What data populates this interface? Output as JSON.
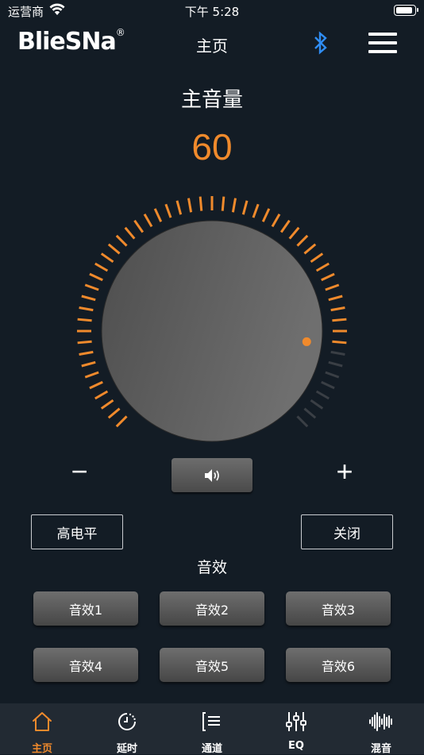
{
  "status_bar": {
    "carrier": "运营商",
    "time": "下午 5:28",
    "battery_level": 1.0
  },
  "nav": {
    "logo": "BlieSNa",
    "logo_mark": "®",
    "title": "主页"
  },
  "volume": {
    "label": "主音量",
    "value": 60,
    "max": 70
  },
  "controls": {
    "minus": "−",
    "plus": "+",
    "high_level": "高电平",
    "close": "关闭"
  },
  "effects": {
    "label": "音效",
    "buttons": [
      "音效1",
      "音效2",
      "音效3",
      "音效4",
      "音效5",
      "音效6"
    ]
  },
  "tabs": [
    {
      "label": "主页",
      "icon": "home-icon",
      "active": true
    },
    {
      "label": "延时",
      "icon": "clock-icon",
      "active": false
    },
    {
      "label": "通道",
      "icon": "list-icon",
      "active": false
    },
    {
      "label": "EQ",
      "icon": "sliders-icon",
      "active": false
    },
    {
      "label": "混音",
      "icon": "waveform-icon",
      "active": false
    }
  ],
  "colors": {
    "accent": "#f08a2c",
    "bluetooth": "#2f8df4",
    "background": "#131c25"
  }
}
